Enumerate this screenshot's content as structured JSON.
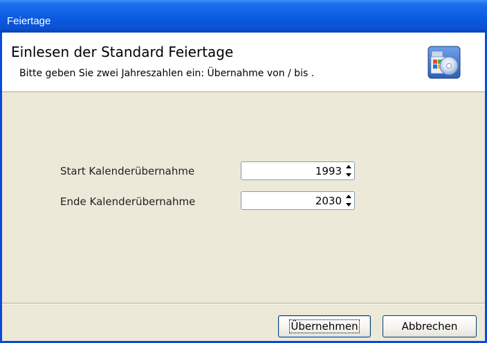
{
  "window": {
    "title": "Feiertage"
  },
  "header": {
    "heading": "Einlesen der Standard Feiertage",
    "subtitle": "Bitte geben Sie zwei Jahreszahlen ein: Übernahme von / bis .",
    "icon": "software-install-icon"
  },
  "form": {
    "start_label": "Start Kalenderübernahme",
    "start_value": "1993",
    "end_label": "Ende Kalenderübernahme",
    "end_value": "2030"
  },
  "buttons": {
    "ok_label": "Übernehmen",
    "cancel_label": "Abbrechen"
  },
  "colors": {
    "titlebar": "#0b5be0",
    "dialog_bg": "#ece9d8",
    "header_bg": "#ffffff",
    "field_border": "#7f9db9",
    "button_border": "#003c74"
  }
}
